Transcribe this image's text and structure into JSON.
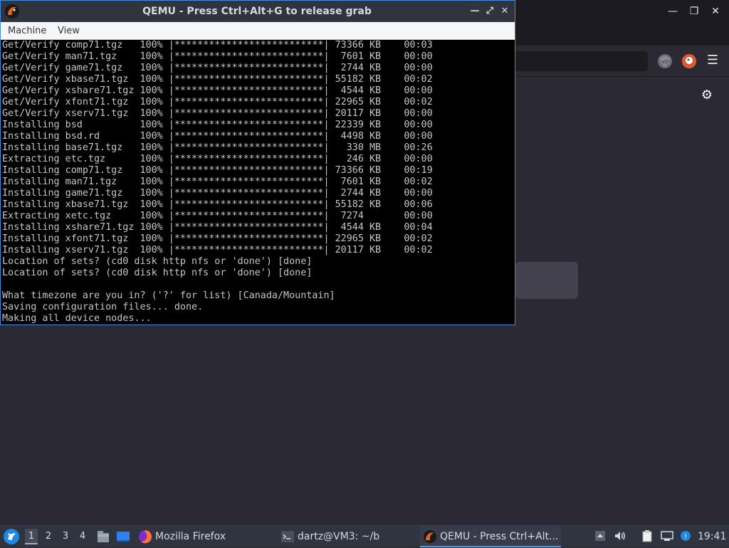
{
  "qemu": {
    "title": "QEMU - Press Ctrl+Alt+G to release grab",
    "menu": [
      "Machine",
      "View"
    ],
    "terminal_lines": [
      "Get/Verify comp71.tgz   100% |**************************| 73366 KB    00:03",
      "Get/Verify man71.tgz    100% |**************************|  7601 KB    00:00",
      "Get/Verify game71.tgz   100% |**************************|  2744 KB    00:00",
      "Get/Verify xbase71.tgz  100% |**************************| 55182 KB    00:02",
      "Get/Verify xshare71.tgz 100% |**************************|  4544 KB    00:00",
      "Get/Verify xfont71.tgz  100% |**************************| 22965 KB    00:02",
      "Get/Verify xserv71.tgz  100% |**************************| 20117 KB    00:00",
      "Installing bsd          100% |**************************| 22339 KB    00:00",
      "Installing bsd.rd       100% |**************************|  4498 KB    00:00",
      "Installing base71.tgz   100% |**************************|   330 MB    00:26",
      "Extracting etc.tgz      100% |**************************|   246 KB    00:00",
      "Installing comp71.tgz   100% |**************************| 73366 KB    00:19",
      "Installing man71.tgz    100% |**************************|  7601 KB    00:02",
      "Installing game71.tgz   100% |**************************|  2744 KB    00:00",
      "Installing xbase71.tgz  100% |**************************| 55182 KB    00:06",
      "Extracting xetc.tgz     100% |**************************|  7274       00:00",
      "Installing xshare71.tgz 100% |**************************|  4544 KB    00:04",
      "Installing xfont71.tgz  100% |**************************| 22965 KB    00:02",
      "Installing xserv71.tgz  100% |**************************| 20117 KB    00:02",
      "Location of sets? (cd0 disk http nfs or 'done') [done]",
      "Location of sets? (cd0 disk http nfs or 'done') [done]",
      "",
      "What timezone are you in? ('?' for list) [Canada/Mountain]",
      "Saving configuration files... done.",
      "Making all device nodes..."
    ]
  },
  "taskbar": {
    "workspaces": [
      "1",
      "2",
      "3",
      "4"
    ],
    "tasks": [
      {
        "label": "Mozilla Firefox",
        "icon": "firefox-icon"
      },
      {
        "label": "dartz@VM3: ~/b",
        "icon": "terminal-icon"
      },
      {
        "label": "QEMU - Press Ctrl+Alt...",
        "icon": "qemu-icon"
      }
    ],
    "clock": "19:41"
  },
  "colors": {
    "accent": "#5294e2",
    "panel": "#2f343f",
    "terminal_text": "#c6c6c6"
  }
}
